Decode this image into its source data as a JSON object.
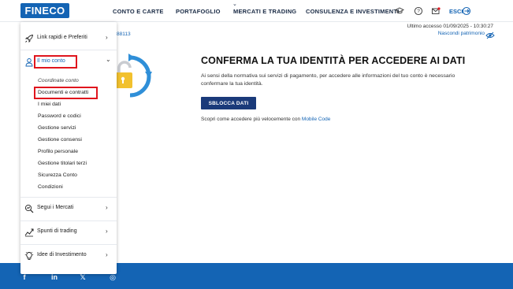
{
  "brand": {
    "logo_text": "FINECO"
  },
  "nav": {
    "items": [
      {
        "label": "CONTO E CARTE"
      },
      {
        "label": "PORTAFOGLIO"
      },
      {
        "label": "MERCATI E TRADING"
      },
      {
        "label": "CONSULENZA E INVESTIMENTI"
      }
    ],
    "esci_label": "ESCI"
  },
  "account": {
    "last_access": "Ultimo accesso 01/09/2025 - 10:30:27",
    "hide_assets": "Nascondi patrimonio",
    "number_fragment": "88113"
  },
  "main": {
    "title": "CONFERMA LA TUA IDENTITÀ PER ACCEDERE AI DATI",
    "description": "Ai sensi della normativa sui servizi di pagamento, per accedere alle informazioni del tuo conto è necessario confermare la tua identità.",
    "button_label": "SBLOCCA DATI",
    "mobile_note": "Scopri come accedere più velocemente con ",
    "mobile_link": "Mobile Code"
  },
  "menu": {
    "items": [
      {
        "label": "Link rapidi e Preferiti",
        "icon": "rocket-icon",
        "chevron": "›"
      },
      {
        "label": "Il mio conto",
        "icon": "person-icon",
        "chevron": "⌄"
      },
      {
        "label": "Segui i Mercati",
        "icon": "magnifier-chart-icon",
        "chevron": "›"
      },
      {
        "label": "Spunti di trading",
        "icon": "trading-icon",
        "chevron": "›"
      },
      {
        "label": "Idee di Investimento",
        "icon": "lightbulb-icon",
        "chevron": "›"
      }
    ],
    "sub_items": [
      {
        "label": "Coordinate conto"
      },
      {
        "label": "Documenti e contratti"
      },
      {
        "label": "I miei dati"
      },
      {
        "label": "Password e codici"
      },
      {
        "label": "Gestione servizi"
      },
      {
        "label": "Gestione consensi"
      },
      {
        "label": "Profilo personale"
      },
      {
        "label": "Gestione titolari terzi"
      },
      {
        "label": "Sicurezza Conto"
      },
      {
        "label": "Condizioni"
      }
    ]
  },
  "footer": {
    "social": [
      {
        "label": "f",
        "icon": "facebook-icon"
      },
      {
        "label": "in",
        "icon": "linkedin-icon"
      },
      {
        "label": "𝕏",
        "icon": "x-icon"
      },
      {
        "label": "◎",
        "icon": "instagram-icon"
      }
    ]
  },
  "colors": {
    "brand_blue": "#1464b4",
    "button_navy": "#1a3a7a",
    "highlight_red": "#e0151d",
    "lock_yellow": "#f2c12e",
    "arrow_blue": "#2f8fd8"
  }
}
